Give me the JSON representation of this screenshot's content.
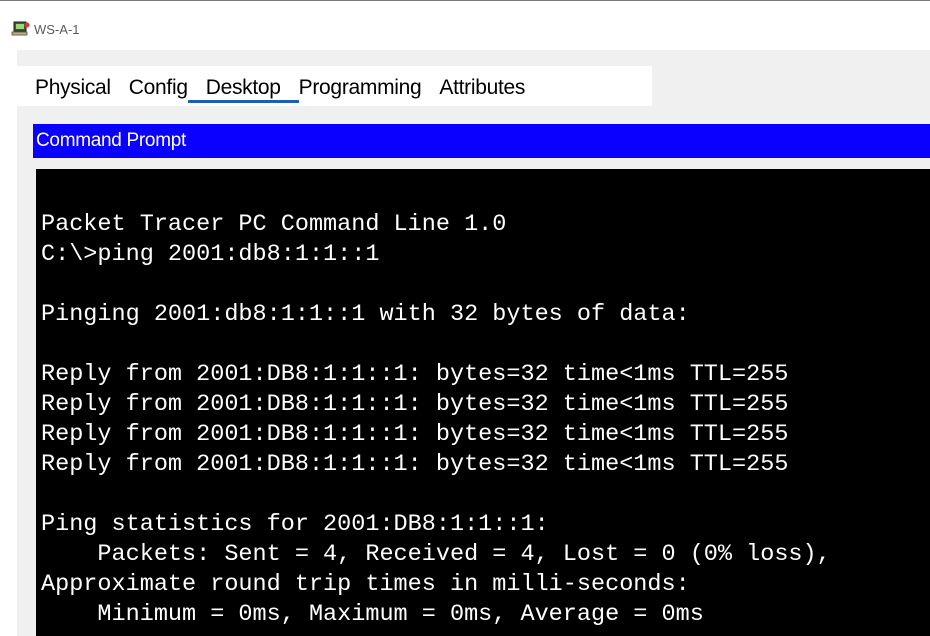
{
  "window": {
    "title": "WS-A-1",
    "icon": "packet-tracer-pc-icon"
  },
  "tabs": [
    {
      "label": "Physical",
      "active": false
    },
    {
      "label": "Config",
      "active": false
    },
    {
      "label": "Desktop",
      "active": true
    },
    {
      "label": "Programming",
      "active": false
    },
    {
      "label": "Attributes",
      "active": false
    }
  ],
  "command_prompt": {
    "title": "Command Prompt",
    "lines": [
      "Packet Tracer PC Command Line 1.0",
      "C:\\>ping 2001:db8:1:1::1",
      "",
      "Pinging 2001:db8:1:1::1 with 32 bytes of data:",
      "",
      "Reply from 2001:DB8:1:1::1: bytes=32 time<1ms TTL=255",
      "Reply from 2001:DB8:1:1::1: bytes=32 time<1ms TTL=255",
      "Reply from 2001:DB8:1:1::1: bytes=32 time<1ms TTL=255",
      "Reply from 2001:DB8:1:1::1: bytes=32 time<1ms TTL=255",
      "",
      "Ping statistics for 2001:DB8:1:1::1:",
      "    Packets: Sent = 4, Received = 4, Lost = 0 (0% loss),",
      "Approximate round trip times in milli-seconds:",
      "    Minimum = 0ms, Maximum = 0ms, Average = 0ms"
    ]
  },
  "colors": {
    "header_bg": "#0a00ff",
    "terminal_bg": "#000000",
    "terminal_fg": "#ffffff",
    "active_tab_underline": "#1a5fb4"
  }
}
